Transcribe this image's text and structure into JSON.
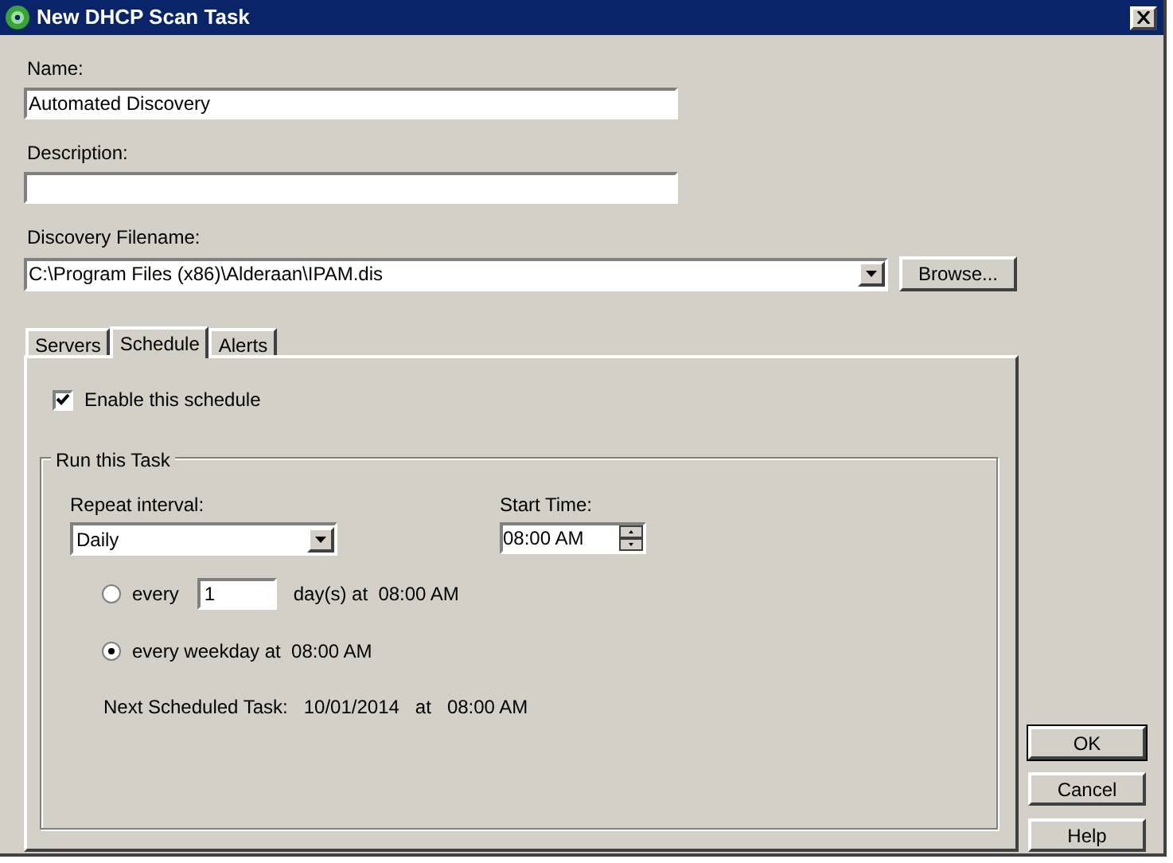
{
  "window": {
    "title": "New DHCP Scan Task"
  },
  "name": {
    "label": "Name:",
    "value": "Automated Discovery"
  },
  "description": {
    "label": "Description:"
  },
  "discovery_filename": {
    "label": "Discovery Filename:",
    "value": "C:\\Program Files (x86)\\Alderaan\\IPAM.dis",
    "button": "Browse..."
  },
  "tabs": [
    {
      "label": "Servers",
      "selected": false
    },
    {
      "label": "Schedule",
      "selected": true
    },
    {
      "label": "Alerts",
      "selected": false
    }
  ],
  "schedule": {
    "enable": {
      "label": "Enable this schedule",
      "checked": true
    },
    "group_title": "Run this Task",
    "repeat_interval": {
      "label": "Repeat interval:",
      "value": "Daily"
    },
    "start_time": {
      "label": "Start Time:",
      "value": "08:00 AM"
    },
    "options": [
      {
        "kind": "count",
        "selected": false,
        "prefix": "every",
        "value": "1",
        "suffix": "day(s) at  08:00 AM"
      },
      {
        "kind": "plain",
        "selected": true,
        "label": "every weekday at  08:00 AM"
      }
    ],
    "next": {
      "label": "Next Scheduled Task:",
      "date": "10/01/2014",
      "at": "at",
      "time": "08:00 AM"
    }
  },
  "buttons": [
    {
      "label": "OK",
      "default": true
    },
    {
      "label": "Cancel",
      "default": false
    },
    {
      "label": "Help",
      "default": false
    }
  ]
}
